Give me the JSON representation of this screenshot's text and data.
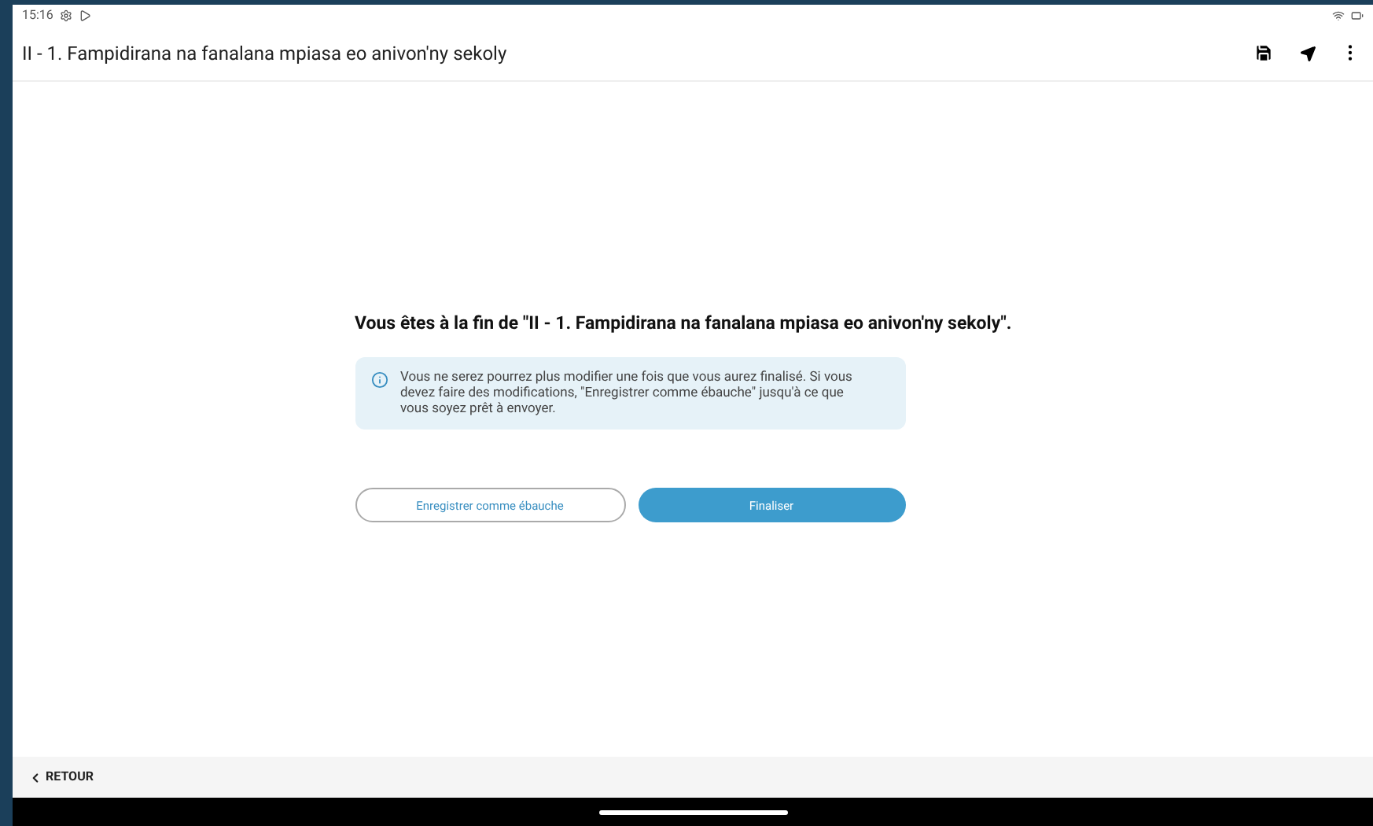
{
  "status_bar": {
    "time": "15:16"
  },
  "app_bar": {
    "title": "II - 1. Fampidirana na fanalana mpiasa eo anivon'ny sekoly"
  },
  "end_screen": {
    "heading": "Vous êtes à la fin de \"II - 1. Fampidirana na fanalana mpiasa eo anivon'ny sekoly\".",
    "info": "Vous ne serez pourrez plus modifier une fois que vous aurez finalisé. Si vous devez faire des modifications, \"Enregistrer comme ébauche\" jusqu'à ce que vous soyez prêt à envoyer.",
    "buttons": [
      {
        "label": "Enregistrer comme ébauche",
        "kind": "outline"
      },
      {
        "label": "Finaliser",
        "kind": "primary"
      }
    ]
  },
  "bottom_bar": {
    "back": "RETOUR"
  }
}
